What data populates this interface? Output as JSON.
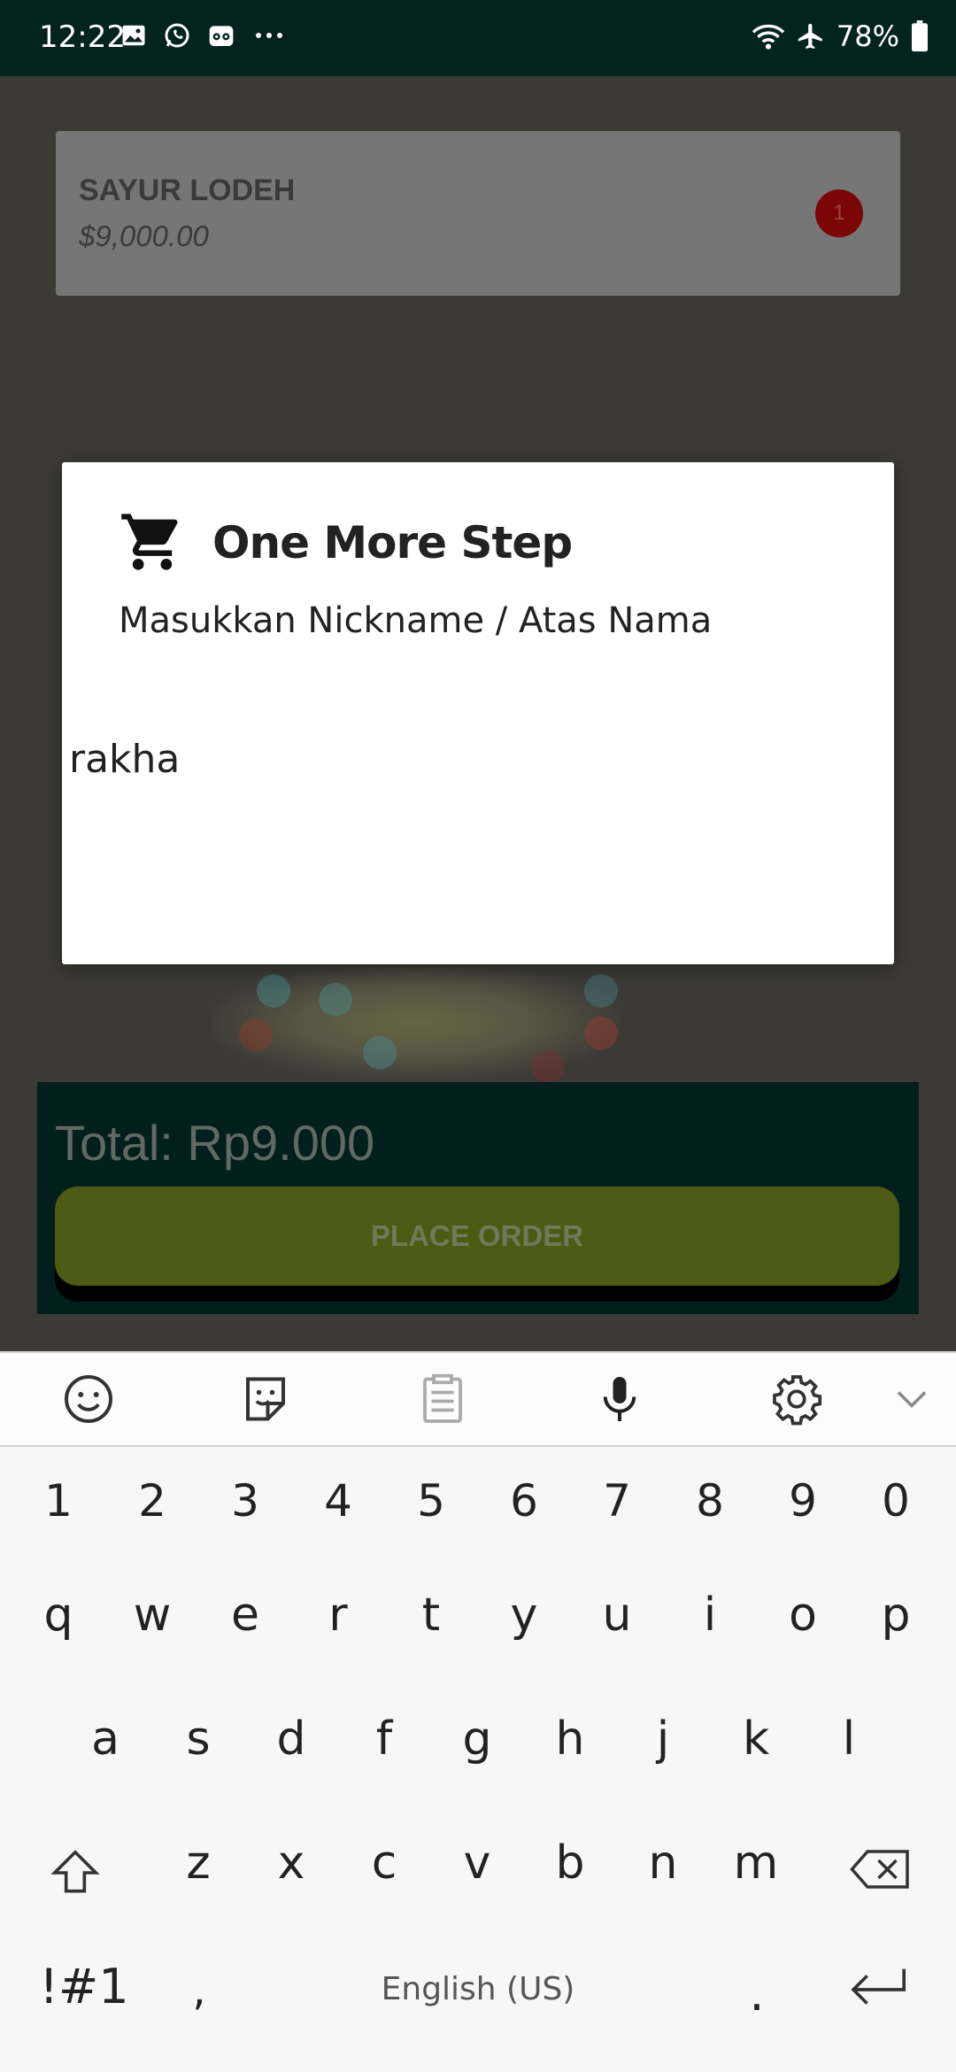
{
  "status_bar": {
    "time": "12:22",
    "battery": "78%",
    "left_icons": [
      "gallery-icon",
      "whatsapp-icon",
      "tripadvisor-icon",
      "more-dots-icon"
    ],
    "right_icons": [
      "wifi-icon",
      "airplane-icon",
      "battery-icon"
    ]
  },
  "cart_item": {
    "name": "SAYUR LODEH",
    "price": "$9,000.00",
    "quantity": "1"
  },
  "footer": {
    "total_label": "Total: Rp9.000",
    "place_order_label": "PLACE ORDER"
  },
  "dialog": {
    "icon": "shopping-cart-icon",
    "title": "One More Step",
    "message": "Masukkan Nickname /  Atas Nama",
    "input_value": "rakha"
  },
  "keyboard": {
    "toolbar": [
      "emoji-icon",
      "sticker-icon",
      "clipboard-icon",
      "microphone-icon",
      "gear-icon",
      "chevron-down-icon"
    ],
    "number_row": [
      "1",
      "2",
      "3",
      "4",
      "5",
      "6",
      "7",
      "8",
      "9",
      "0"
    ],
    "row1": [
      "q",
      "w",
      "e",
      "r",
      "t",
      "y",
      "u",
      "i",
      "o",
      "p"
    ],
    "row2": [
      "a",
      "s",
      "d",
      "f",
      "g",
      "h",
      "j",
      "k",
      "l"
    ],
    "row3": [
      "z",
      "x",
      "c",
      "v",
      "b",
      "n",
      "m"
    ],
    "symbols_key": "!#1",
    "comma_key": ",",
    "space_label": "English (US)",
    "period_key": "."
  },
  "colors": {
    "status_bar": "#03231f",
    "total_bar": "#021f1c",
    "place_order_button": "#4d5a14",
    "badge": "#7a0606"
  }
}
